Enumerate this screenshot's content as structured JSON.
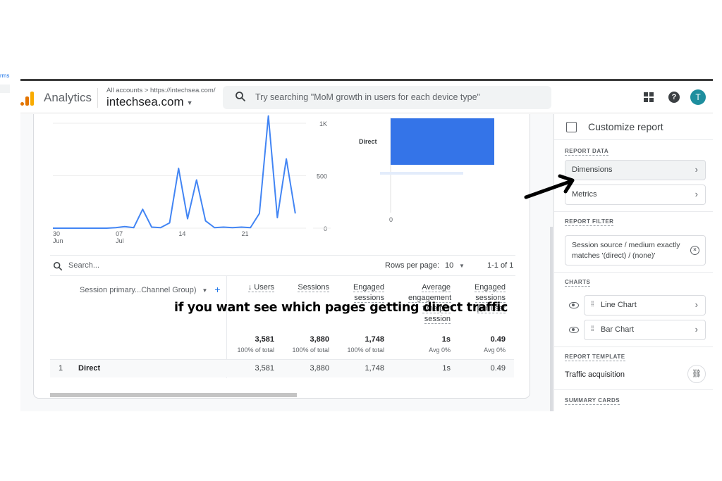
{
  "stray": {
    "link_text": "rms"
  },
  "header": {
    "app_name": "Analytics",
    "breadcrumb": "All accounts > https://intechsea.com/",
    "property": "intechsea.com",
    "search_placeholder": "Try searching \"MoM growth in users for each device type\"",
    "avatar_letter": "T",
    "help_glyph": "?"
  },
  "chart_data": [
    {
      "type": "line",
      "title": "",
      "x": [
        "30 Jun",
        "01 Jul",
        "02 Jul",
        "03 Jul",
        "04 Jul",
        "05 Jul",
        "06 Jul",
        "07 Jul",
        "08 Jul",
        "09 Jul",
        "10 Jul",
        "11 Jul",
        "12 Jul",
        "13 Jul",
        "14 Jul",
        "15 Jul",
        "16 Jul",
        "17 Jul",
        "18 Jul",
        "19 Jul",
        "20 Jul",
        "21 Jul",
        "22 Jul",
        "23 Jul",
        "24 Jul",
        "25 Jul",
        "26 Jul",
        "27 Jul"
      ],
      "x_tick_labels": [
        {
          "day": "30",
          "month": "Jun",
          "index": 0
        },
        {
          "day": "07",
          "month": "Jul",
          "index": 7
        },
        {
          "day": "14",
          "month": "",
          "index": 14
        },
        {
          "day": "21",
          "month": "",
          "index": 21
        }
      ],
      "series": [
        {
          "name": "Users",
          "color": "#4285f4",
          "values": [
            0,
            0,
            0,
            0,
            0,
            0,
            0,
            5,
            15,
            5,
            180,
            10,
            5,
            50,
            570,
            90,
            460,
            70,
            5,
            10,
            5,
            10,
            5,
            140,
            1070,
            100,
            660,
            140
          ]
        }
      ],
      "y_ticks": [
        "0",
        "500",
        "1K"
      ],
      "ylim": [
        0,
        1000
      ],
      "grid": true,
      "xlabel": "",
      "ylabel": ""
    },
    {
      "type": "bar",
      "categories": [
        "Direct"
      ],
      "values": [
        3581
      ],
      "x_ticks": [
        "0"
      ],
      "color": "#3474e8",
      "xlabel": "",
      "ylabel": ""
    }
  ],
  "table": {
    "search_placeholder": "Search...",
    "rows_per_page_label": "Rows per page:",
    "rows_per_page": "10",
    "pagination": "1-1 of 1",
    "dimension_header": "Session primary...Channel Group)",
    "add_dimension": "+",
    "columns": [
      {
        "label": "↓ Users",
        "total": "3,581",
        "total_sub": "100% of total"
      },
      {
        "label": "Sessions",
        "total": "3,880",
        "total_sub": "100% of total"
      },
      {
        "label": "Engaged sessions",
        "total": "1,748",
        "total_sub": "100% of total"
      },
      {
        "label": "Average engagement time per session",
        "total": "1s",
        "total_sub": "Avg 0%"
      },
      {
        "label": "Engaged sessions per user",
        "total": "0.49",
        "total_sub": "Avg 0%"
      }
    ],
    "rows": [
      {
        "index": "1",
        "name": "Direct",
        "values": [
          "3,581",
          "3,880",
          "1,748",
          "1s",
          "0.49"
        ]
      }
    ]
  },
  "panel": {
    "title": "Customize report",
    "report_data_heading": "REPORT DATA",
    "dimensions_label": "Dimensions",
    "metrics_label": "Metrics",
    "report_filter_heading": "REPORT FILTER",
    "filter_text": "Session source / medium exactly matches '(direct) / (none)'",
    "charts_heading": "CHARTS",
    "charts": [
      {
        "label": "Line Chart"
      },
      {
        "label": "Bar Chart"
      }
    ],
    "report_template_heading": "REPORT TEMPLATE",
    "template_name": "Traffic acquisition",
    "summary_cards_heading": "SUMMARY CARDS",
    "chevron": "›"
  },
  "annotation": {
    "text": "if you want see which pages getting direct traffic"
  }
}
